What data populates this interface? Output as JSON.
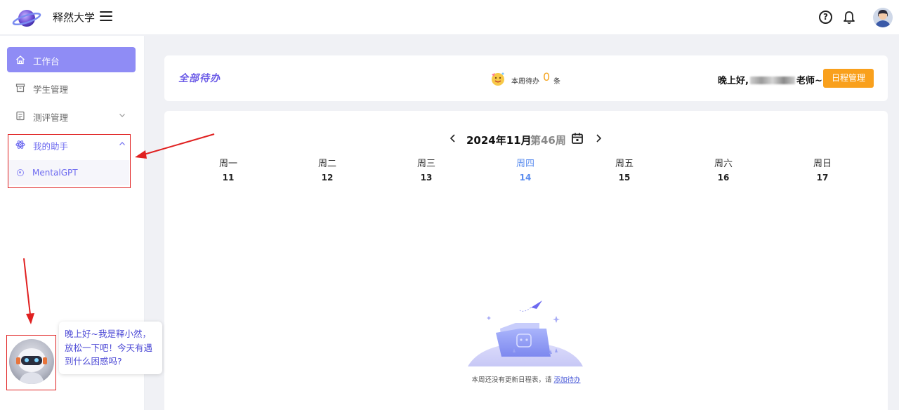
{
  "header": {
    "app_title": "释然大学",
    "logo_icon": "planet-logo-icon",
    "menu_icon": "hamburger-icon",
    "help_icon": "help-icon",
    "help_glyph": "?",
    "notify_icon": "bell-icon"
  },
  "sidebar": {
    "items": [
      {
        "label": "工作台",
        "icon": "home-icon",
        "active": true
      },
      {
        "label": "学生管理",
        "icon": "archive-icon"
      },
      {
        "label": "测评管理",
        "icon": "clipboard-icon",
        "expandable": true
      },
      {
        "label": "我的助手",
        "icon": "atom-icon",
        "expanded": true
      }
    ],
    "submenu": [
      {
        "label": "MentalGPT",
        "icon": "circle-dot-icon"
      }
    ]
  },
  "todo_card": {
    "title": "全部待办",
    "week_label": "本周待办",
    "week_count": "0",
    "week_unit": "条",
    "greeting_prefix": "晚上好,",
    "greeting_suffix": "老师~",
    "schedule_button": "日程管理"
  },
  "calendar": {
    "month": "2024年11月",
    "week": "第46周",
    "days": [
      {
        "name": "周一",
        "date": "11"
      },
      {
        "name": "周二",
        "date": "12"
      },
      {
        "name": "周三",
        "date": "13"
      },
      {
        "name": "周四",
        "date": "14",
        "today": true
      },
      {
        "name": "周五",
        "date": "15"
      },
      {
        "name": "周六",
        "date": "16"
      },
      {
        "name": "周日",
        "date": "17"
      }
    ],
    "empty_text": "本周还没有更新日程表，请",
    "empty_link": "添加待办"
  },
  "assistant": {
    "bubble_text": "晚上好~我是释小然，放松一下吧！今天有遇到什么困惑吗?"
  },
  "colors": {
    "accent": "#8f8cf5",
    "orange": "#f9a01c",
    "today": "#5b8def",
    "annotation": "#e02020"
  }
}
